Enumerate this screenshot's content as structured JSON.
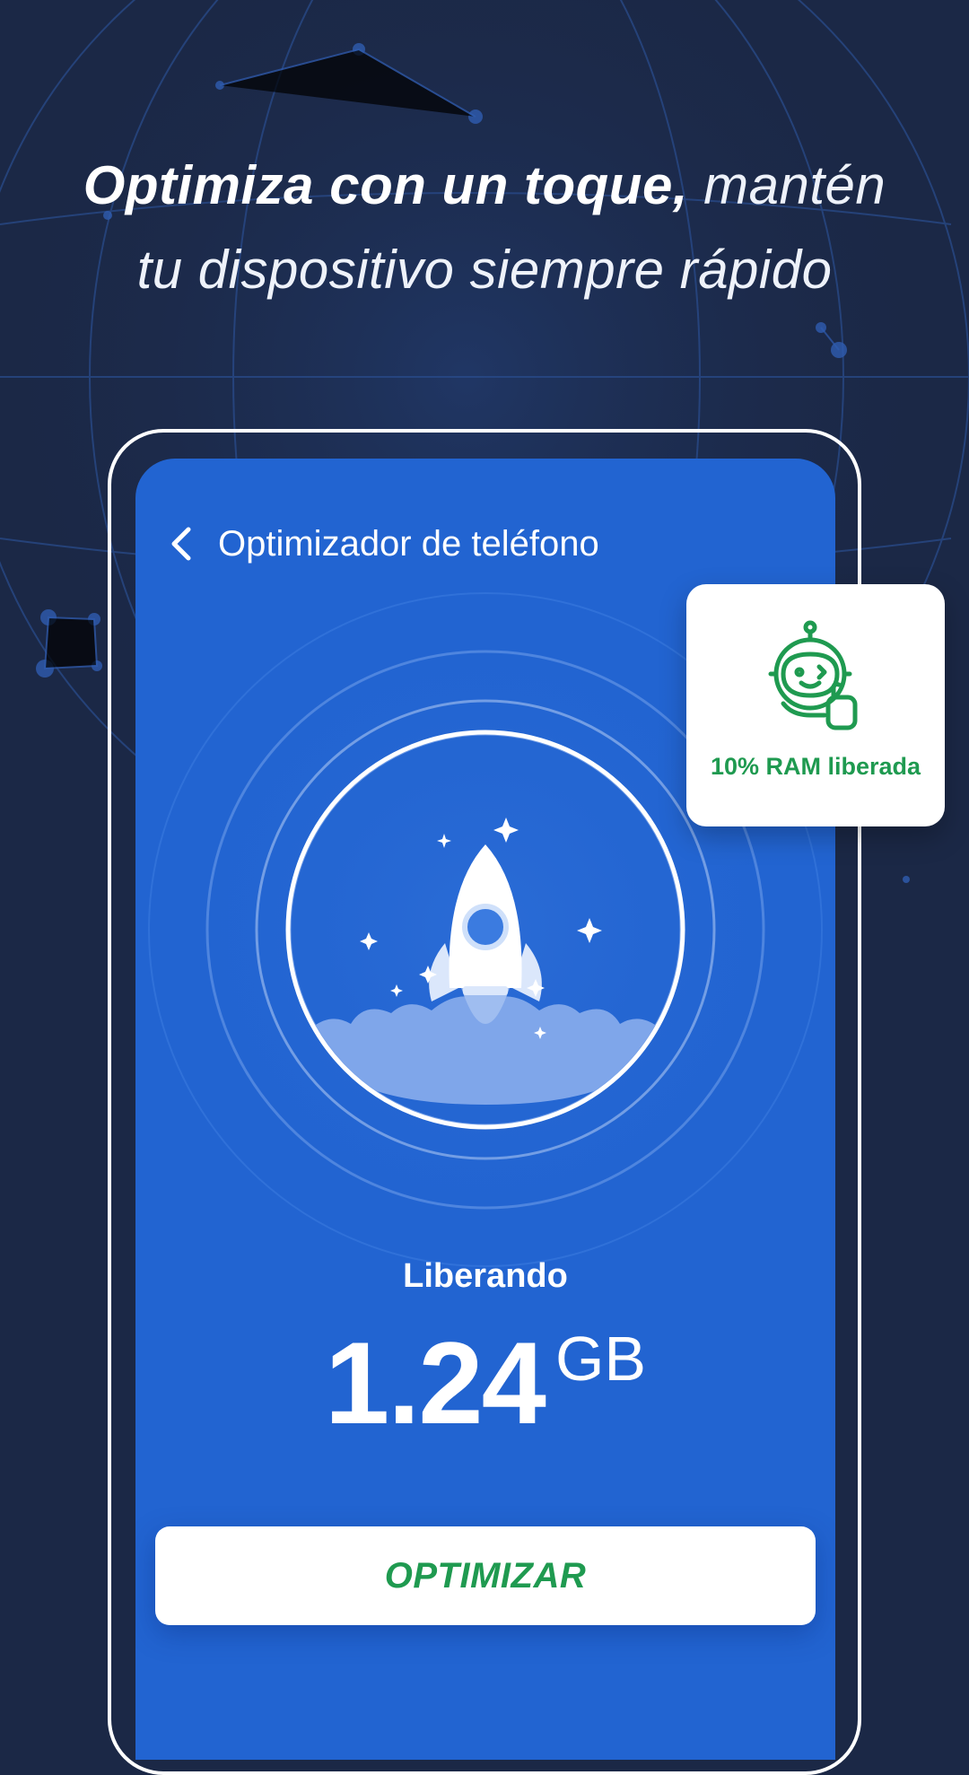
{
  "headline": {
    "bold": "Optimiza con un toque,",
    "light_1": "mantén",
    "light_2": "tu dispositivo siempre rápido"
  },
  "screen": {
    "title": "Optimizador de teléfono",
    "back_icon": "chevron-left-icon",
    "status_label": "Liberando",
    "amount": "1.24",
    "unit": "GB",
    "optimize_button": "OPTIMIZAR"
  },
  "ram_card": {
    "icon": "robot-icon",
    "label": "10% RAM liberada"
  },
  "colors": {
    "background": "#1b2846",
    "screen_blue": "#2264d1",
    "accent_green": "#1f9a50",
    "white": "#ffffff"
  }
}
